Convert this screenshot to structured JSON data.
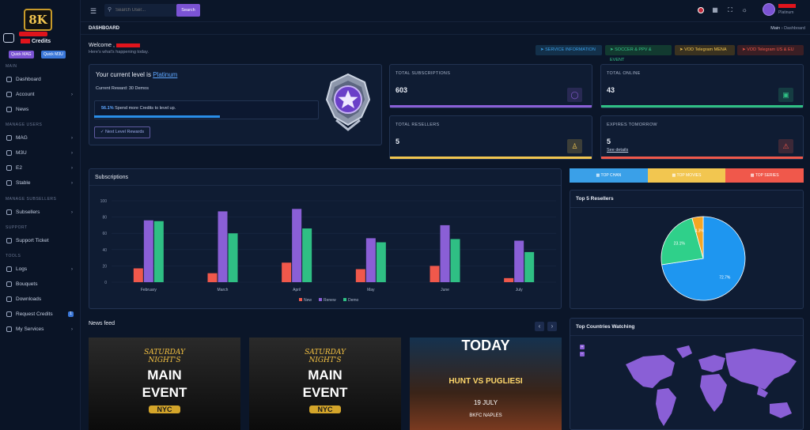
{
  "sidebar": {
    "logo_text": "8K",
    "credits_label": "Credits",
    "quick_mag": "Quick MAG",
    "quick_m3u": "Quick M3U",
    "sections": {
      "main": "MAIN",
      "manage_users": "MANAGE USERS",
      "manage_subsellers": "MANAGE SUBSELLERS",
      "support": "SUPPORT",
      "tools": "TOOLS"
    },
    "items": [
      {
        "label": "Dashboard",
        "chevron": false
      },
      {
        "label": "Account",
        "chevron": true
      },
      {
        "label": "News",
        "chevron": false
      },
      {
        "label": "MAG",
        "chevron": true
      },
      {
        "label": "M3U",
        "chevron": true
      },
      {
        "label": "E2",
        "chevron": true
      },
      {
        "label": "Stable",
        "chevron": true
      },
      {
        "label": "Subsellers",
        "chevron": true
      },
      {
        "label": "Support Ticket",
        "chevron": false
      },
      {
        "label": "Logs",
        "chevron": true
      },
      {
        "label": "Bouquets",
        "chevron": false
      },
      {
        "label": "Downloads",
        "chevron": false
      },
      {
        "label": "Request Credits",
        "chevron": false,
        "badge": "1"
      },
      {
        "label": "My Services",
        "chevron": true
      }
    ]
  },
  "topbar": {
    "search_placeholder": "Search User...",
    "search_button": "Search",
    "user_level": "Platinum"
  },
  "breadcrumb": {
    "title": "DASHBOARD",
    "home": "Main",
    "current": "Dashboard"
  },
  "welcome": {
    "title": "Welcome ,",
    "subtitle": "Here's what's happening today."
  },
  "chips": [
    {
      "label": "SERVICE INFORMATION",
      "color": "#3aa0e8",
      "bg": "#13304a"
    },
    {
      "label": "SOCCER & PPV & EVENT",
      "color": "#37c98b",
      "bg": "#123a30"
    },
    {
      "label": "VOD Telegram MENA",
      "color": "#f2c650",
      "bg": "#3a3220"
    },
    {
      "label": "VOD Telegram US & EU",
      "color": "#f0584b",
      "bg": "#3a1e24"
    }
  ],
  "level": {
    "title": "Your current level is",
    "level_name": "Platinum",
    "reward": "Current Reward: 30 Demos",
    "progress_pct": "56.1%",
    "progress_text": "Spend more Credits to level up.",
    "progress_value": 0.561,
    "button": "Next Level Rewards"
  },
  "stats": [
    {
      "label": "TOTAL SUBSCRIPTIONS",
      "value": "603",
      "color": "#8a5fd6",
      "icon": "globe-icon"
    },
    {
      "label": "TOTAL ONLINE",
      "value": "43",
      "color": "#2fbf84",
      "icon": "monitor-icon"
    },
    {
      "label": "TOTAL RESELLERS",
      "value": "5",
      "color": "#f2c650",
      "icon": "person-icon"
    },
    {
      "label": "EXPIRES TOMORROW",
      "value": "5",
      "color": "#f0584b",
      "icon": "warning-icon",
      "link": "See details"
    }
  ],
  "tabs": [
    {
      "label": "TOP CHAN",
      "color": "#3aa0e8"
    },
    {
      "label": "TOP MOVIES",
      "color": "#f2c650"
    },
    {
      "label": "TOP SERIES",
      "color": "#f0584b"
    }
  ],
  "panels": {
    "subscriptions": "Subscriptions",
    "top_resellers": "Top 5 Resellers",
    "news_feed": "News feed",
    "top_countries": "Top Countries Watching"
  },
  "chart_data": [
    {
      "type": "bar",
      "title": "Subscriptions",
      "categories": [
        "February",
        "March",
        "April",
        "May",
        "June",
        "July"
      ],
      "series": [
        {
          "name": "New",
          "color": "#f0584b",
          "values": [
            17,
            11,
            24,
            16,
            20,
            5
          ]
        },
        {
          "name": "Renew",
          "color": "#8a5fd6",
          "values": [
            76,
            87,
            90,
            54,
            70,
            51
          ]
        },
        {
          "name": "Demo",
          "color": "#2fbf84",
          "values": [
            75,
            60,
            66,
            49,
            53,
            37
          ]
        }
      ],
      "yticks": [
        0,
        20,
        40,
        60,
        80,
        100
      ],
      "ylim": [
        0,
        100
      ],
      "legend": "bottom"
    },
    {
      "type": "pie",
      "title": "Top 5 Resellers",
      "slices": [
        {
          "label": "72.7%",
          "value": 72.7,
          "color": "#1e96f0"
        },
        {
          "label": "23.1%",
          "value": 23.1,
          "color": "#2fd08a"
        },
        {
          "label": "4.3%",
          "value": 4.3,
          "color": "#f5a623"
        }
      ]
    }
  ],
  "news": [
    {
      "line1": "SATURDAY NIGHT'S",
      "line2": "MAIN",
      "line3": "EVENT",
      "tag": "NYC"
    },
    {
      "line1": "SATURDAY NIGHT'S",
      "line2": "MAIN",
      "line3": "EVENT",
      "tag": "NYC"
    },
    {
      "line1": "TODAY",
      "line2": "HUNT VS PUGLIESI",
      "line3": "19 JULY",
      "tag": "BKFC NAPLES"
    }
  ]
}
